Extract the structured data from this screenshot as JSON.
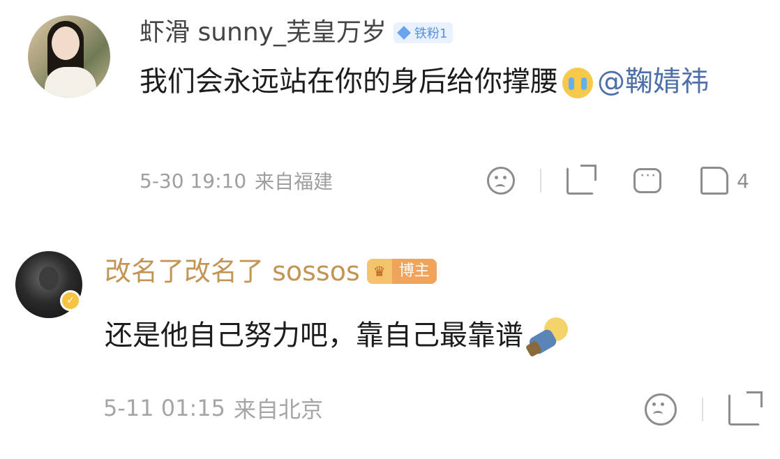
{
  "comments": [
    {
      "username": "虾滑 sunny_芜皇万岁",
      "fan_badge": "铁粉1",
      "text": "我们会永远站在你的身后给你撑腰",
      "mention": "@鞠婧祎",
      "time": "5-30 19:10",
      "location": "来自福建",
      "like_count": "4"
    },
    {
      "username": "改名了改名了 sossos",
      "host_badge": "博主",
      "text": "还是他自己努力吧，靠自己最靠谱",
      "time": "5-11 01:15",
      "location": "来自北京"
    }
  ],
  "icons": {
    "emoji_1": "crying-face-emoji",
    "emoji_2": "lightbulb-emoji",
    "dislike": "frown-face-icon",
    "share": "share-icon",
    "reply": "comment-icon",
    "like": "thumbs-up-icon"
  },
  "colors": {
    "username": "#444444",
    "host_username": "#c39555",
    "mention": "#4e6fa8",
    "meta": "#9e9e9e",
    "fan_badge": "#5a8fe0",
    "host_badge": "#f0a35a"
  }
}
